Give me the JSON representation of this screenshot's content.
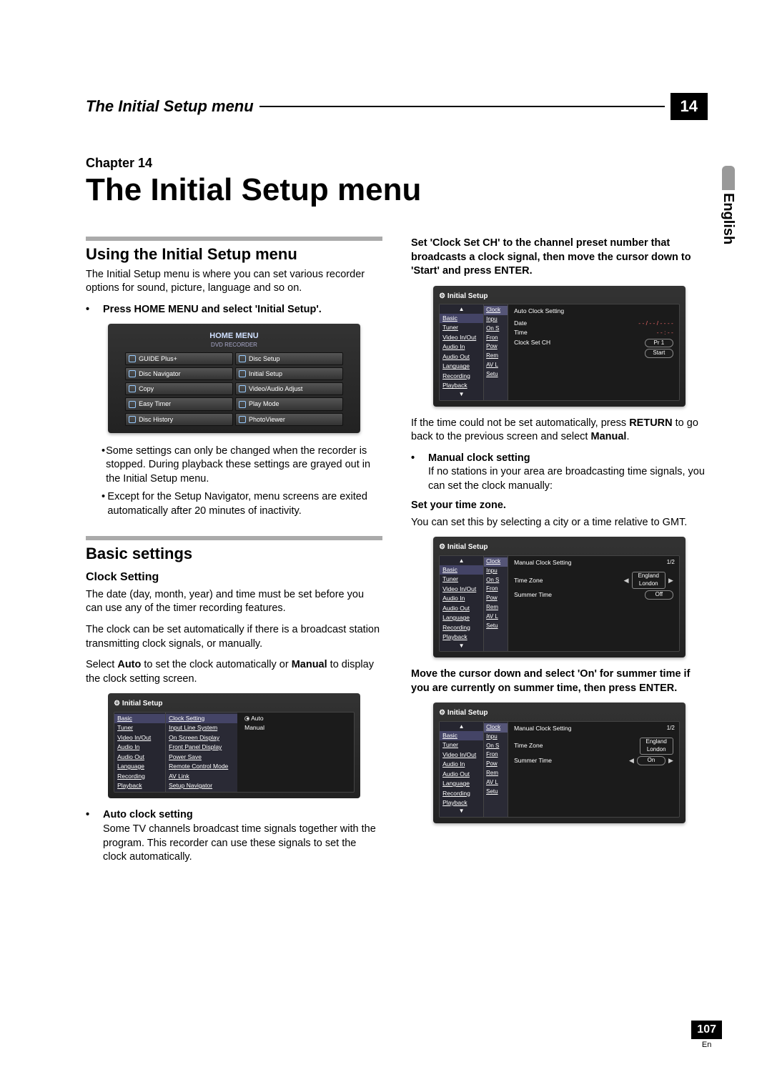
{
  "header": {
    "section_title": "The Initial Setup menu",
    "chapter_badge": "14"
  },
  "side": {
    "language": "English",
    "page_number": "107",
    "page_lang": "En"
  },
  "chapter": {
    "label": "Chapter 14",
    "title": "The Initial Setup menu"
  },
  "left": {
    "sec1_h": "Using the Initial Setup menu",
    "sec1_p1": "The Initial Setup menu is where you can set various recorder options for sound, picture, language and so on.",
    "sec1_bullet": "Press HOME MENU and select 'Initial Setup'.",
    "home_menu_title": "HOME MENU",
    "home_menu_sub": "DVD RECORDER",
    "home_items": {
      "a": "GUIDE Plus+",
      "b": "Disc Setup",
      "c": "Disc Navigator",
      "d": "Initial Setup",
      "e": "Copy",
      "f": "Video/Audio Adjust",
      "g": "Easy Timer",
      "h": "Play Mode",
      "i": "Disc History",
      "j": "PhotoViewer"
    },
    "note1": "Some settings can only be changed when the recorder is stopped. During playback these settings are grayed out in the Initial Setup menu.",
    "note2": "Except for the Setup Navigator, menu screens are exited automatically after 20 minutes of inactivity.",
    "sec2_h": "Basic settings",
    "clock_h": "Clock Setting",
    "clock_p1": "The date (day, month, year) and time must be set before you can use any of the timer recording features.",
    "clock_p2": "The clock can be set automatically if there is a broadcast station transmitting clock signals, or manually.",
    "clock_p3a": "Select ",
    "clock_p3b": "Auto",
    "clock_p3c": " to set the clock automatically or ",
    "clock_p3d": "Manual",
    "clock_p3e": " to display the clock setting screen.",
    "setup_title": "Initial Setup",
    "setup_side": [
      "Basic",
      "Tuner",
      "Video In/Out",
      "Audio In",
      "Audio Out",
      "Language",
      "Recording",
      "Playback"
    ],
    "setup_mid": [
      "Clock Setting",
      "Input Line System",
      "On Screen Display",
      "Front Panel Display",
      "Power Save",
      "Remote Control Mode",
      "AV Link",
      "Setup Navigator"
    ],
    "setup_opts": {
      "auto": "Auto",
      "manual": "Manual"
    },
    "auto_h": "Auto clock setting",
    "auto_p": "Some TV channels broadcast time signals together with the program. This recorder can use these signals to set the clock automatically."
  },
  "right": {
    "intro_bold": "Set 'Clock Set CH' to the channel preset number that broadcasts a clock signal, then move the cursor down to 'Start' and press ENTER.",
    "osd1_title": "Initial Setup",
    "osd1_side": [
      "Basic",
      "Tuner",
      "Video In/Out",
      "Audio In",
      "Audio Out",
      "Language",
      "Recording",
      "Playback"
    ],
    "osd1_mid_trunc": [
      "Clock",
      "Inpu",
      "On S",
      "Fron",
      "Pow",
      "Rem",
      "AV L",
      "Setu"
    ],
    "osd1_main_h": "Auto Clock Setting",
    "osd1_rows": {
      "date_l": "Date",
      "date_v": "- - / - - / - - - -",
      "time_l": "Time",
      "time_v": "- - : - -",
      "ch_l": "Clock Set CH",
      "ch_v": "Pr 1",
      "start": "Start"
    },
    "p_after1a": "If the time could not be set automatically, press ",
    "p_after1b": "RETURN",
    "p_after1c": " to go back to the previous screen and select ",
    "p_after1d": "Manual",
    "p_after1e": ".",
    "manual_h": "Manual clock setting",
    "manual_p": "If no stations in your area are broadcasting time signals, you can set the clock manually:",
    "tz_h": "Set your time zone.",
    "tz_p": "You can set this by selecting a city or a time relative to GMT.",
    "osd2_title": "Initial Setup",
    "osd2_main_h": "Manual Clock Setting",
    "osd2_page": "1/2",
    "osd2_rows": {
      "tz_l": "Time Zone",
      "tz_v1": "England",
      "tz_v2": "London",
      "st_l": "Summer Time",
      "st_off": "Off"
    },
    "p_after2": "Move the cursor down and select 'On' for summer time if you are currently on summer time, then press ENTER.",
    "osd3_title": "Initial Setup",
    "osd3_main_h": "Manual Clock Setting",
    "osd3_page": "1/2",
    "osd3_rows": {
      "tz_l": "Time Zone",
      "tz_v1": "England",
      "tz_v2": "London",
      "st_l": "Summer Time",
      "st_on": "On"
    }
  }
}
